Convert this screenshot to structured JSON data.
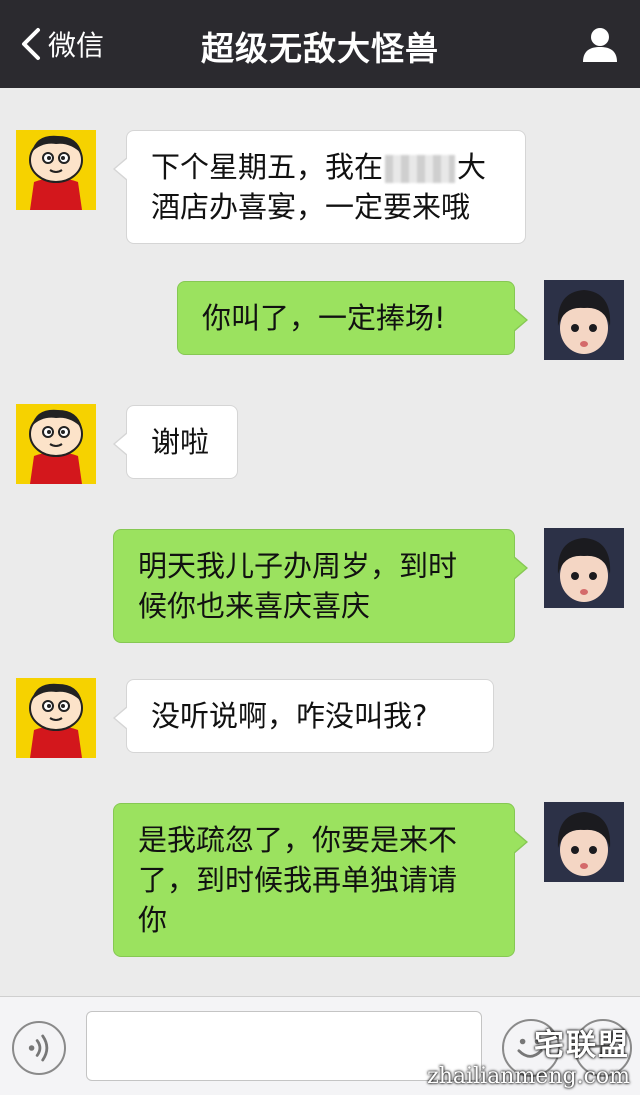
{
  "nav": {
    "back_label": "微信",
    "title": "超级无敌大怪兽"
  },
  "messages": [
    {
      "side": "in",
      "line1_pre": "下个星期五，我在",
      "line1_post": "大",
      "line2": "酒店办喜宴，一定要来哦"
    },
    {
      "side": "out",
      "text": "你叫了，一定捧场!"
    },
    {
      "side": "in",
      "text": "谢啦"
    },
    {
      "side": "out",
      "line1": "明天我儿子办周岁，到时",
      "line2": "候你也来喜庆喜庆"
    },
    {
      "side": "in",
      "text": "没听说啊，咋没叫我?"
    },
    {
      "side": "out",
      "line1": "是我疏忽了，你要是来不",
      "line2": "了，到时候我再单独请请",
      "line3": "你"
    }
  ],
  "input": {
    "placeholder": ""
  },
  "watermark": {
    "cn": "宅联盟",
    "en": "zhailianmeng.com"
  },
  "colors": {
    "navbar": "#2b2a2f",
    "background": "#ebebeb",
    "bubble_in": "#ffffff",
    "bubble_out": "#9be25f"
  }
}
